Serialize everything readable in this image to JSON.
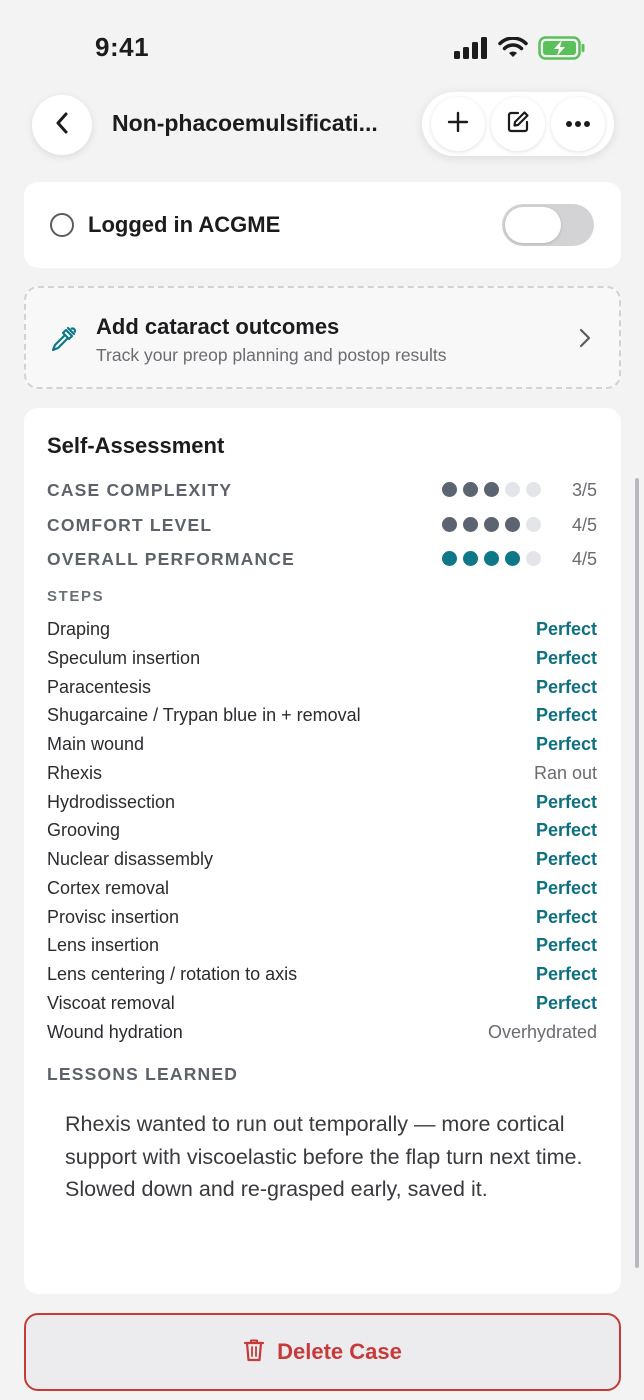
{
  "status_bar": {
    "time": "9:41",
    "icons": [
      "signal-icon",
      "wifi-icon",
      "battery-charging-icon"
    ]
  },
  "nav": {
    "title": "Non-phacoemulsificati...",
    "actions": [
      "plus-icon",
      "edit-icon",
      "more-icon"
    ]
  },
  "acgme": {
    "label": "Logged in ACGME",
    "toggle_on": false
  },
  "outcomes": {
    "title": "Add cataract outcomes",
    "subtitle": "Track your preop planning and postop results"
  },
  "self_assessment": {
    "title": "Self-Assessment",
    "ratings": [
      {
        "label": "CASE COMPLEXITY",
        "value": 3,
        "max": 5,
        "display": "3/5",
        "color": "#5b6470"
      },
      {
        "label": "COMFORT LEVEL",
        "value": 4,
        "max": 5,
        "display": "4/5",
        "color": "#5b6470"
      },
      {
        "label": "OVERALL PERFORMANCE",
        "value": 4,
        "max": 5,
        "display": "4/5",
        "color": "#0e7888"
      }
    ],
    "steps_label": "STEPS",
    "steps": [
      {
        "name": "Draping",
        "result": "Perfect"
      },
      {
        "name": "Speculum insertion",
        "result": "Perfect"
      },
      {
        "name": "Paracentesis",
        "result": "Perfect"
      },
      {
        "name": "Shugarcaine / Trypan blue in + removal",
        "result": "Perfect"
      },
      {
        "name": "Main wound",
        "result": "Perfect"
      },
      {
        "name": "Rhexis",
        "result": "Ran out"
      },
      {
        "name": "Hydrodissection",
        "result": "Perfect"
      },
      {
        "name": "Grooving",
        "result": "Perfect"
      },
      {
        "name": "Nuclear disassembly",
        "result": "Perfect"
      },
      {
        "name": "Cortex removal",
        "result": "Perfect"
      },
      {
        "name": "Provisc insertion",
        "result": "Perfect"
      },
      {
        "name": "Lens insertion",
        "result": "Perfect"
      },
      {
        "name": "Lens centering / rotation to axis",
        "result": "Perfect"
      },
      {
        "name": "Viscoat removal",
        "result": "Perfect"
      },
      {
        "name": "Wound hydration",
        "result": "Overhydrated"
      }
    ],
    "lessons_label": "LESSONS LEARNED",
    "lessons_text": "Rhexis wanted to run out temporally — more cortical support with viscoelastic before the flap turn next time. Slowed down and re-grasped early, saved it."
  },
  "delete": {
    "label": "Delete Case",
    "color": "#c73a3a"
  },
  "colors": {
    "accent": "#0e7888",
    "perfect": "#0e7080"
  }
}
